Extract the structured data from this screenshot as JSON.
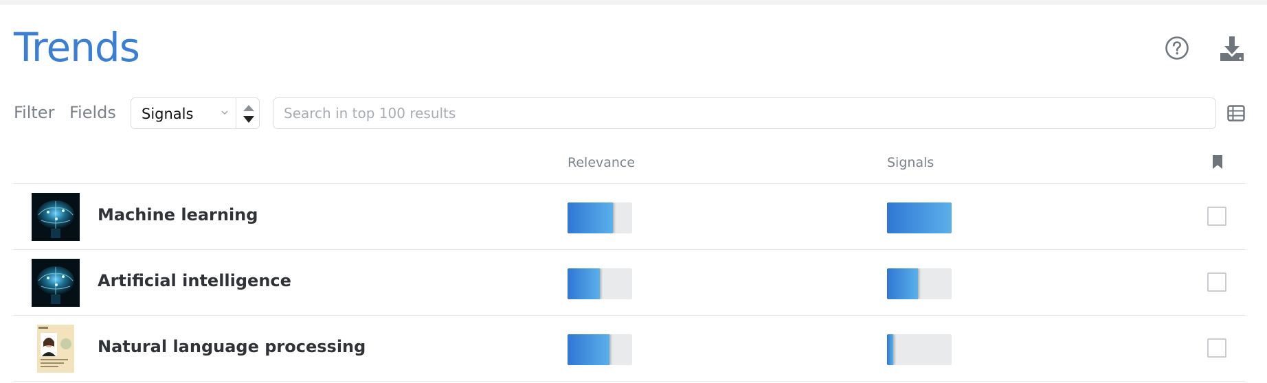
{
  "header": {
    "title": "Trends"
  },
  "icons": {
    "help": "question-circle-icon",
    "download": "download-tray-icon",
    "list_view": "list-view-icon",
    "bookmark": "bookmark-icon"
  },
  "toolbar": {
    "filter_label": "Filter",
    "fields_label": "Fields",
    "select_value": "Signals",
    "search_placeholder": "Search in top 100 results"
  },
  "columns": {
    "relevance": "Relevance",
    "signals": "Signals"
  },
  "accent_color": "#3a7fd5",
  "rows": [
    {
      "name": "Machine learning",
      "thumbnail": "brain-circuit-image",
      "relevance": 0.7,
      "signals": 1.0,
      "bookmarked": false
    },
    {
      "name": "Artificial intelligence",
      "thumbnail": "brain-circuit-image",
      "relevance": 0.5,
      "signals": 0.48,
      "bookmarked": false
    },
    {
      "name": "Natural language processing",
      "thumbnail": "id-card-image",
      "relevance": 0.65,
      "signals": 0.1,
      "bookmarked": false
    }
  ]
}
